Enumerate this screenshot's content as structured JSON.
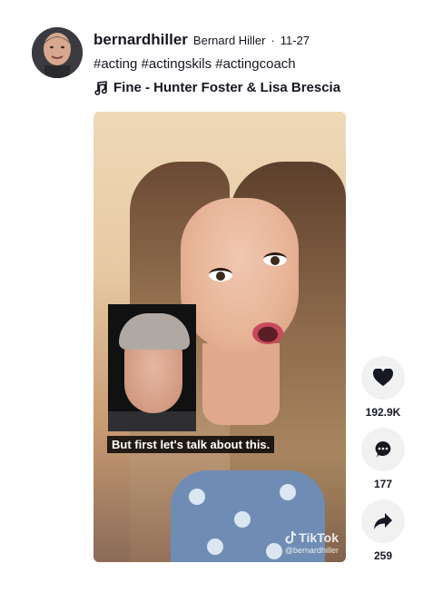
{
  "post": {
    "username": "bernardhiller",
    "nickname": "Bernard Hiller",
    "separator": "·",
    "date": "11-27",
    "caption": "#acting #actingskils #actingcoach",
    "music": "Fine - Hunter Foster & Lisa Brescia"
  },
  "video": {
    "subtitle": "But first let's talk about this.",
    "watermark_brand": "TikTok",
    "watermark_handle": "@bernardhiller"
  },
  "actions": {
    "likes": "192.9K",
    "comments": "177",
    "shares": "259"
  },
  "icons": {
    "music": "music-note-icon",
    "like": "heart-icon",
    "comment": "comment-bubble-icon",
    "share": "share-arrow-icon",
    "brand": "tiktok-logo-icon"
  }
}
